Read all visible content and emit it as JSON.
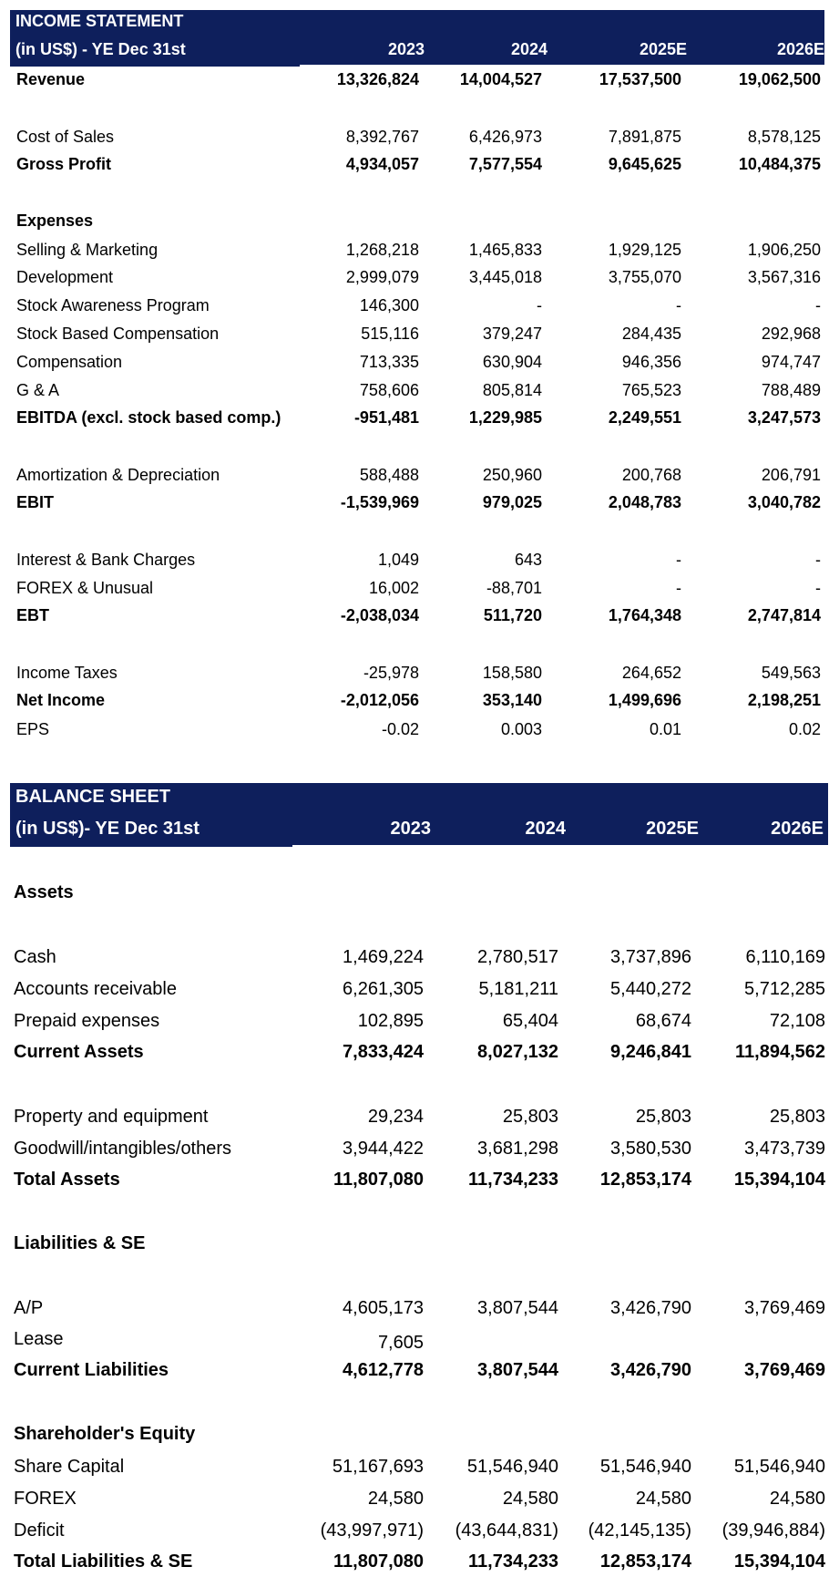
{
  "income_statement": {
    "title": "INCOME STATEMENT",
    "subtitle": "(in US$) - YE Dec 31st",
    "years": [
      "2023",
      "2024",
      "2025E",
      "2026E"
    ],
    "rows": [
      {
        "label": "Revenue",
        "values": [
          "13,326,824",
          "14,004,527",
          "17,537,500",
          "19,062,500"
        ],
        "bold": true
      },
      {
        "label": "Cost of Sales",
        "values": [
          "8,392,767",
          "6,426,973",
          "7,891,875",
          "8,578,125"
        ]
      },
      {
        "label": "Gross Profit",
        "values": [
          "4,934,057",
          "7,577,554",
          "9,645,625",
          "10,484,375"
        ],
        "bold": true
      },
      {
        "label": "Expenses",
        "values": [
          "",
          "",
          "",
          ""
        ],
        "bold": true
      },
      {
        "label": "Selling & Marketing",
        "values": [
          "1,268,218",
          "1,465,833",
          "1,929,125",
          "1,906,250"
        ]
      },
      {
        "label": "Development",
        "values": [
          "2,999,079",
          "3,445,018",
          "3,755,070",
          "3,567,316"
        ]
      },
      {
        "label": "Stock Awareness Program",
        "values": [
          "146,300",
          "-",
          "-",
          "-"
        ]
      },
      {
        "label": "Stock Based Compensation",
        "values": [
          "515,116",
          "379,247",
          "284,435",
          "292,968"
        ]
      },
      {
        "label": "Compensation",
        "values": [
          "713,335",
          "630,904",
          "946,356",
          "974,747"
        ]
      },
      {
        "label": "G & A",
        "values": [
          "758,606",
          "805,814",
          "765,523",
          "788,489"
        ]
      },
      {
        "label": "EBITDA (excl. stock based comp.)",
        "values": [
          "-951,481",
          "1,229,985",
          "2,249,551",
          "3,247,573"
        ],
        "bold": true
      },
      {
        "label": "Amortization & Depreciation",
        "values": [
          "588,488",
          "250,960",
          "200,768",
          "206,791"
        ]
      },
      {
        "label": "EBIT",
        "values": [
          "-1,539,969",
          "979,025",
          "2,048,783",
          "3,040,782"
        ],
        "bold": true
      },
      {
        "label": "Interest & Bank Charges",
        "values": [
          "1,049",
          "643",
          "-",
          "-"
        ]
      },
      {
        "label": "FOREX & Unusual",
        "values": [
          "16,002",
          "-88,701",
          "-",
          "-"
        ]
      },
      {
        "label": "EBT",
        "values": [
          "-2,038,034",
          "511,720",
          "1,764,348",
          "2,747,814"
        ],
        "bold": true
      },
      {
        "label": "Income Taxes",
        "values": [
          "-25,978",
          "158,580",
          "264,652",
          "549,563"
        ]
      },
      {
        "label": "Net Income",
        "values": [
          "-2,012,056",
          "353,140",
          "1,499,696",
          "2,198,251"
        ],
        "bold": true
      },
      {
        "label": "EPS",
        "values": [
          "-0.02",
          "0.003",
          "0.01",
          "0.02"
        ]
      }
    ]
  },
  "balance_sheet": {
    "title": "BALANCE SHEET",
    "subtitle": "(in US$)- YE Dec 31st",
    "years": [
      "2023",
      "2024",
      "2025E",
      "2026E"
    ],
    "rows": [
      {
        "label": "Assets",
        "values": [
          "",
          "",
          "",
          ""
        ],
        "bold": true
      },
      {
        "label": "Cash",
        "values": [
          "1,469,224",
          "2,780,517",
          "3,737,896",
          "6,110,169"
        ]
      },
      {
        "label": "Accounts receivable",
        "values": [
          "6,261,305",
          "5,181,211",
          "5,440,272",
          "5,712,285"
        ]
      },
      {
        "label": "Prepaid expenses",
        "values": [
          "102,895",
          "65,404",
          "68,674",
          "72,108"
        ]
      },
      {
        "label": "Current Assets",
        "values": [
          "7,833,424",
          "8,027,132",
          "9,246,841",
          "11,894,562"
        ],
        "bold": true
      },
      {
        "label": "Property and equipment",
        "values": [
          "29,234",
          "25,803",
          "25,803",
          "25,803"
        ]
      },
      {
        "label": "Goodwill/intangibles/others",
        "values": [
          "3,944,422",
          "3,681,298",
          "3,580,530",
          "3,473,739"
        ]
      },
      {
        "label": "Total Assets",
        "values": [
          "11,807,080",
          "11,734,233",
          "12,853,174",
          "15,394,104"
        ],
        "bold": true
      },
      {
        "label": "Liabilities & SE",
        "values": [
          "",
          "",
          "",
          ""
        ],
        "bold": true
      },
      {
        "label": "A/P",
        "values": [
          "4,605,173",
          "3,807,544",
          "3,426,790",
          "3,769,469"
        ]
      },
      {
        "label": "Lease",
        "values": [
          "7,605",
          "",
          "",
          ""
        ]
      },
      {
        "label": "Current Liabilities",
        "values": [
          "4,612,778",
          "3,807,544",
          "3,426,790",
          "3,769,469"
        ],
        "bold": true
      },
      {
        "label": "Shareholder's Equity",
        "values": [
          "",
          "",
          "",
          ""
        ],
        "bold": true
      },
      {
        "label": "Share Capital",
        "values": [
          "51,167,693",
          "51,546,940",
          "51,546,940",
          "51,546,940"
        ]
      },
      {
        "label": "FOREX",
        "values": [
          "24,580",
          "24,580",
          "24,580",
          "24,580"
        ]
      },
      {
        "label": "Deficit",
        "values": [
          "(43,997,971)",
          "(43,644,831)",
          "(42,145,135)",
          "(39,946,884)"
        ]
      },
      {
        "label": "Total Liabilities & SE",
        "values": [
          "11,807,080",
          "11,734,233",
          "12,853,174",
          "15,394,104"
        ],
        "bold": true
      }
    ]
  }
}
